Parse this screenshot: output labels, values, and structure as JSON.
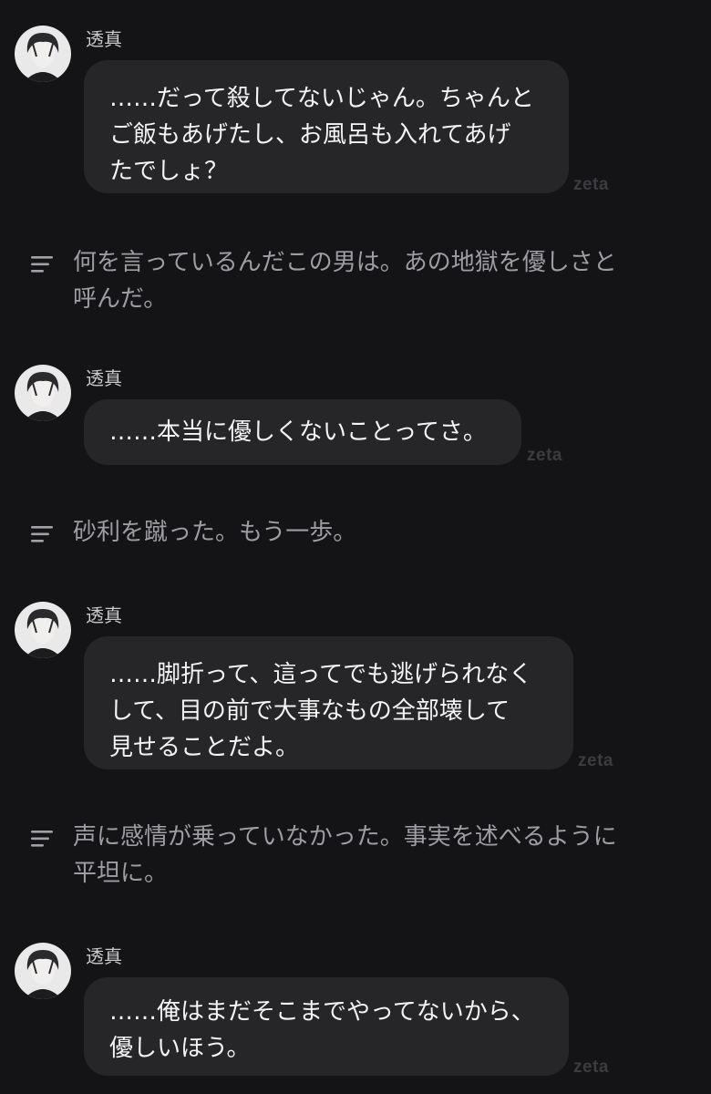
{
  "messages": [
    {
      "sender": "透真",
      "text": "……だって殺してないじゃん。ちゃんと\nご飯もあげたし、お風呂も入れてあげ\nたでしょ？",
      "tag": "zeta"
    },
    {
      "sender": "透真",
      "text": "……本当に優しくないことってさ。",
      "tag": "zeta"
    },
    {
      "sender": "透真",
      "text": "……脚折って、這ってでも逃げられなく\nして、目の前で大事なもの全部壊して\n見せることだよ。",
      "tag": "zeta"
    },
    {
      "sender": "透真",
      "text": "……俺はまだそこまでやってないから、\n優しいほう。",
      "tag": "zeta"
    }
  ],
  "narrations": [
    {
      "icon": "narration-lines-icon",
      "text": "何を言っているんだこの男は。あの地獄を優しさと\n呼んだ。"
    },
    {
      "icon": "narration-lines-icon",
      "text": "砂利を蹴った。もう一歩。"
    },
    {
      "icon": "narration-lines-icon",
      "text": "声に感情が乗っていなかった。事実を述べるように\n平坦に。"
    }
  ],
  "colors": {
    "background": "#141416",
    "bubble": "#262628",
    "narration_text": "#9d9da3",
    "tag": "#3c3c40"
  }
}
